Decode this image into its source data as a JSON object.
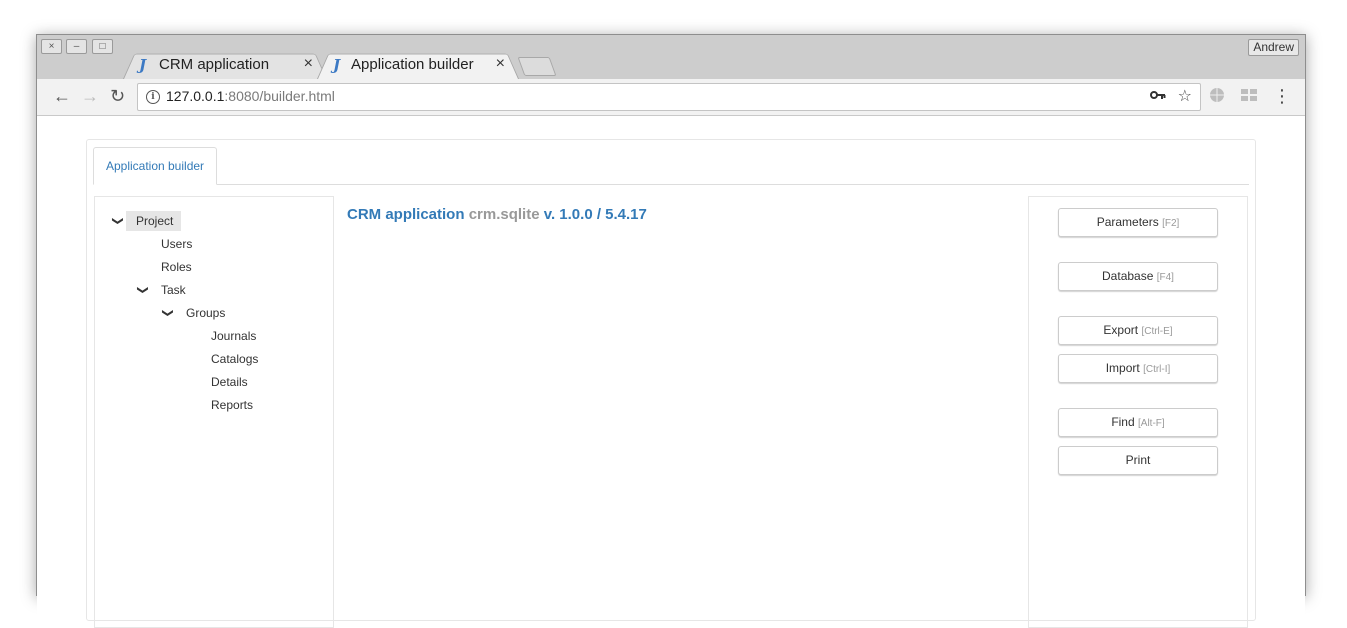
{
  "window": {
    "controls": [
      "×",
      "–",
      "□"
    ],
    "profile_name": "Andrew"
  },
  "tabs": [
    {
      "icon": "J",
      "title": "CRM application",
      "close": "×",
      "active": false
    },
    {
      "icon": "J",
      "title": "Application builder",
      "close": "×",
      "active": true
    }
  ],
  "toolbar": {
    "back": "←",
    "forward": "→",
    "reload": "↻",
    "url_host": "127.0.0.1",
    "url_rest": ":8080/builder.html",
    "key_icon": "key-icon",
    "star": "☆",
    "menu": "⋮"
  },
  "page": {
    "nav_tab": "Application builder",
    "tree": [
      {
        "label": "Project",
        "level": 0,
        "expanded": true,
        "selected": true
      },
      {
        "label": "Users",
        "level": 1,
        "expanded": false
      },
      {
        "label": "Roles",
        "level": 1,
        "expanded": false
      },
      {
        "label": "Task",
        "level": 1,
        "expanded": true
      },
      {
        "label": "Groups",
        "level": 2,
        "expanded": true
      },
      {
        "label": "Journals",
        "level": 3,
        "expanded": false
      },
      {
        "label": "Catalogs",
        "level": 3,
        "expanded": false
      },
      {
        "label": "Details",
        "level": 3,
        "expanded": false
      },
      {
        "label": "Reports",
        "level": 3,
        "expanded": false
      }
    ],
    "title": {
      "app": "CRM application",
      "db": "crm.sqlite",
      "version": "v. 1.0.0 / 5.4.17"
    },
    "buttons": [
      {
        "label": "Parameters",
        "shortcut": "[F2]"
      },
      {
        "label": "Database",
        "shortcut": "[F4]"
      },
      {
        "label": "Export",
        "shortcut": "[Ctrl-E]"
      },
      {
        "label": "Import",
        "shortcut": "[Ctrl-I]"
      },
      {
        "label": "Find",
        "shortcut": "[Alt-F]"
      },
      {
        "label": "Print",
        "shortcut": ""
      }
    ]
  },
  "colors": {
    "link_blue": "#337ab7",
    "muted_gray": "#999999",
    "tab_icon_blue": "#3d7ac4"
  }
}
